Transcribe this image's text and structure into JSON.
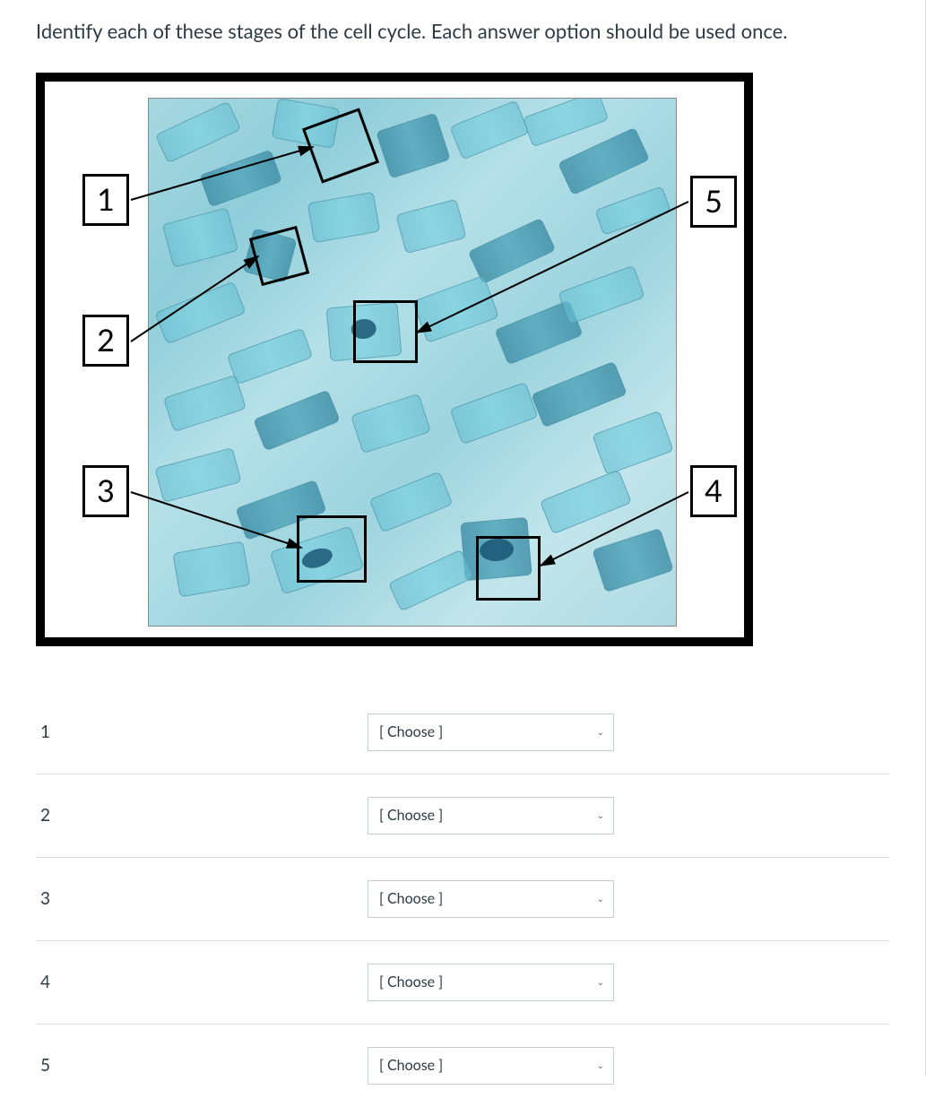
{
  "question": "Identify each of these stages of the cell cycle. Each answer option should be used once.",
  "labels": {
    "l1": "1",
    "l2": "2",
    "l3": "3",
    "l4": "4",
    "l5": "5"
  },
  "answers": [
    {
      "num": "1",
      "selected": "[ Choose ]"
    },
    {
      "num": "2",
      "selected": "[ Choose ]"
    },
    {
      "num": "3",
      "selected": "[ Choose ]"
    },
    {
      "num": "4",
      "selected": "[ Choose ]"
    },
    {
      "num": "5",
      "selected": "[ Choose ]"
    }
  ]
}
